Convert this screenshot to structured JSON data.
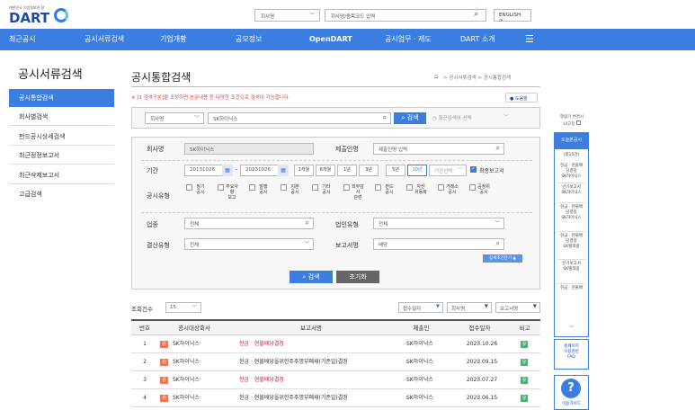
{
  "header": {
    "org_name": "대한민국 기업정보의 창",
    "logo_text": "DART",
    "search_type": "회사명",
    "search_placeholder": "회사명/종목코드 입력",
    "lang_button": "ENGLISH >"
  },
  "nav": {
    "items": [
      "최근공시",
      "공시서류검색",
      "기업개황",
      "공모정보",
      "OpenDART",
      "공시업무 · 제도",
      "DART 소개"
    ],
    "menu_icon": "hamburger-icon"
  },
  "sidebar": {
    "title": "공시서류검색",
    "items": [
      "공시통합검색",
      "회사별검색",
      "펀드공시상세검색",
      "최근정정보고서",
      "최근삭제보고서",
      "고급검색"
    ]
  },
  "main": {
    "title": "공시통합검색",
    "breadcrumb": "> 공시서류검색 > 공시통합검색",
    "notice": "※ [1 검색구분]을 조정하면 본문내용 등 다양한 조건으로 검색이 가능합니다.",
    "help_button": "도움말"
  },
  "search_bar": {
    "type": "회사명",
    "query": "SK하이닉스",
    "search_button": "검색",
    "recent_placeholder": "최근검색어 선택"
  },
  "form": {
    "company_label": "회사명",
    "company_value": "SK하이닉스",
    "submitter_label": "제출인명",
    "submitter_placeholder": "제출인명 입력",
    "period_label": "기간",
    "date_from": "20131026",
    "date_to": "20231026",
    "period_buttons": [
      "1개월",
      "6개월",
      "1년",
      "3년",
      "5년",
      "10년"
    ],
    "period_select": "기간선택",
    "latest_label": "최종보고서",
    "disclosure_type_label": "공시유형",
    "disclosure_types": [
      "정기\n공시",
      "주요사\n항\n보고",
      "발행\n공시",
      "지분\n공시",
      "기타\n공시",
      "외부감\n사\n관련",
      "펀드\n공시",
      "자산\n유동화",
      "거래소\n공시",
      "공정위\n공시"
    ],
    "industry_label": "업종",
    "industry_value": "전체",
    "corp_type_label": "법인유형",
    "corp_type_value": "전체",
    "fiscal_label": "결산유형",
    "fiscal_value": "전체",
    "report_label": "보고서명",
    "report_value": "배당",
    "detail_toggle": "상세조건닫기 ▲",
    "search_button": "검색",
    "reset_button": "초기화"
  },
  "results": {
    "count_label": "조회건수",
    "count_value": "15",
    "sort_options": [
      "접수일자",
      "회사명",
      "보고서명"
    ],
    "headers": [
      "번호",
      "공시대상회사",
      "보고서명",
      "제출인",
      "접수일자",
      "비고"
    ],
    "rows": [
      {
        "no": "1",
        "badge": "유",
        "company": "SK하이닉스",
        "report": "현금 · 현물배당결정",
        "submitter": "SK하이닉스",
        "date": "2023.10.26",
        "note": "유"
      },
      {
        "no": "2",
        "badge": "유",
        "company": "SK하이닉스",
        "report": "현금 · 현물배당을위한주주명부폐쇄(기준일)결정",
        "submitter": "SK하이닉스",
        "date": "2023.09.15",
        "note": "유"
      },
      {
        "no": "3",
        "badge": "유",
        "company": "SK하이닉스",
        "report": "현금 · 현물배당결정",
        "submitter": "SK하이닉스",
        "date": "2023.07.27",
        "note": "유"
      },
      {
        "no": "4",
        "badge": "유",
        "company": "SK하이닉스",
        "report": "현금 · 현물배당을위한주주명부폐쇄(기준일)결정",
        "submitter": "SK하이닉스",
        "date": "2023.06.15",
        "note": "유"
      }
    ]
  },
  "rail": {
    "toggle_text": "열람기 변경시\nUI고정",
    "head": "오늘본공시",
    "count": "(총15건)",
    "items": [
      "현금 · 현물배\n당결정\nSK하이닉스",
      "반기보고서\nSK하이닉스",
      "현금 · 현물배\n당결정\nSK하이닉스",
      "현금 · 현물배\n당결정\nSK텔레콤",
      "분기보고서\nSK텔레콤",
      "현금 · 현물배"
    ],
    "faq": "홈페이지\n이용관련\nFAQ",
    "guide": "이용가이드"
  },
  "colors": {
    "accent": "#3b7ee0",
    "logo": "#1f4aa3",
    "notice": "#e04040",
    "link": "#c2185b"
  }
}
